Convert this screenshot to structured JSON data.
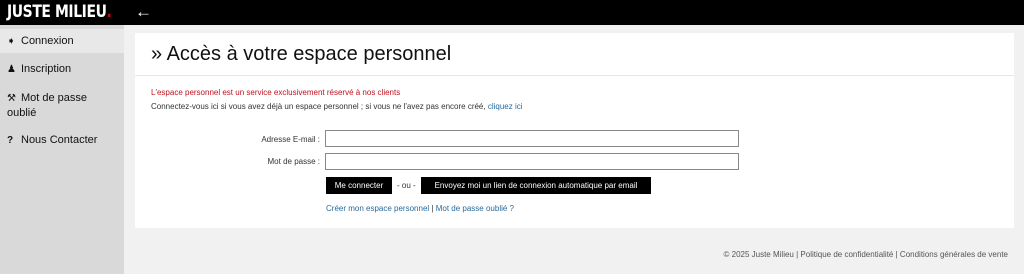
{
  "header": {
    "logo_text": "JUSTE MILIEU",
    "logo_dot": ".",
    "back_icon": "arrow-left-icon",
    "back_glyph": "←"
  },
  "sidebar": {
    "items": [
      {
        "icon": "login-icon",
        "glyph": "➧",
        "label": "Connexion"
      },
      {
        "icon": "user-icon",
        "glyph": "♟",
        "label": "Inscription"
      },
      {
        "icon": "key-icon",
        "glyph": "⚒",
        "label_line1": "Mot de passe",
        "label_line2": "oublié"
      },
      {
        "icon": "question-icon",
        "glyph": "?",
        "label": "Nous Contacter"
      }
    ]
  },
  "main": {
    "title": "» Accès à votre espace personnel",
    "notice_red": "L'espace personnel est un service exclusivement réservé à nos clients",
    "notice_text": "Connectez-vous ici si vous avez déjà un espace personnel ; si vous ne l'avez pas encore créé,",
    "notice_link": "cliquez ici",
    "form": {
      "email_label": "Adresse E-mail :",
      "email_value": "",
      "password_label": "Mot de passe :",
      "password_value": "",
      "login_button": "Me connecter",
      "separator": "- ou -",
      "magic_link_button": "Envoyez moi un lien de connexion automatique par email"
    },
    "links": {
      "create_account": "Créer mon espace personnel",
      "separator": "|",
      "forgot_password": "Mot de passe oublié ?"
    }
  },
  "footer": {
    "copyright": "© 2025 Juste Milieu",
    "sep1": "|",
    "privacy": "Politique de confidentialité",
    "sep2": "|",
    "terms": "Conditions générales de vente"
  }
}
